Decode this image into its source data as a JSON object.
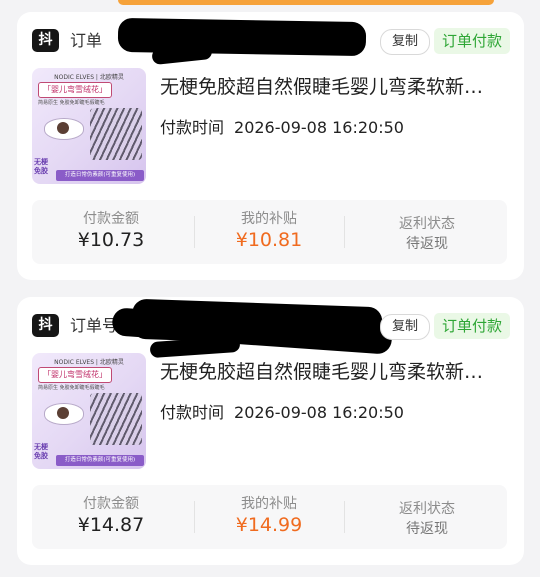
{
  "colors": {
    "page_bg": "#f3f3f5",
    "status_green": "#2ea635",
    "subsidy_orange": "#f06b1f",
    "badge_black": "#161616"
  },
  "orders": [
    {
      "platform_badge": "抖",
      "order_label": "订单",
      "copy_label": "复制",
      "status": "订单付款",
      "thumbnail": {
        "brand": "NODIC ELVES | 北欧精灵",
        "title": "「婴儿弯雪绒花」",
        "subtitle": "简易原生 免胶免卸睫毛假睫毛",
        "side_text": "无梗免胶",
        "banner": "打造日常伪素颜(可重复使用)"
      },
      "product_title": "无梗免胶超自然假睫毛婴儿弯柔软新…",
      "pay_time_label": "付款时间",
      "pay_time_value": "2026-09-08 16:20:50",
      "summary": {
        "amount_label": "付款金额",
        "amount_value": "¥10.73",
        "subsidy_label": "我的补贴",
        "subsidy_value": "¥10.81",
        "rebate_label": "返利状态",
        "rebate_value": "待返现"
      }
    },
    {
      "platform_badge": "抖",
      "order_label": "订单号",
      "copy_label": "复制",
      "status": "订单付款",
      "thumbnail": {
        "brand": "NODIC ELVES | 北欧精灵",
        "title": "「婴儿弯雪绒花」",
        "subtitle": "简易原生 免胶免卸睫毛假睫毛",
        "side_text": "无梗免胶",
        "banner": "打造日常伪素颜(可重复使用)"
      },
      "product_title": "无梗免胶超自然假睫毛婴儿弯柔软新…",
      "pay_time_label": "付款时间",
      "pay_time_value": "2026-09-08 16:20:50",
      "summary": {
        "amount_label": "付款金额",
        "amount_value": "¥14.87",
        "subsidy_label": "我的补贴",
        "subsidy_value": "¥14.99",
        "rebate_label": "返利状态",
        "rebate_value": "待返现"
      }
    }
  ]
}
